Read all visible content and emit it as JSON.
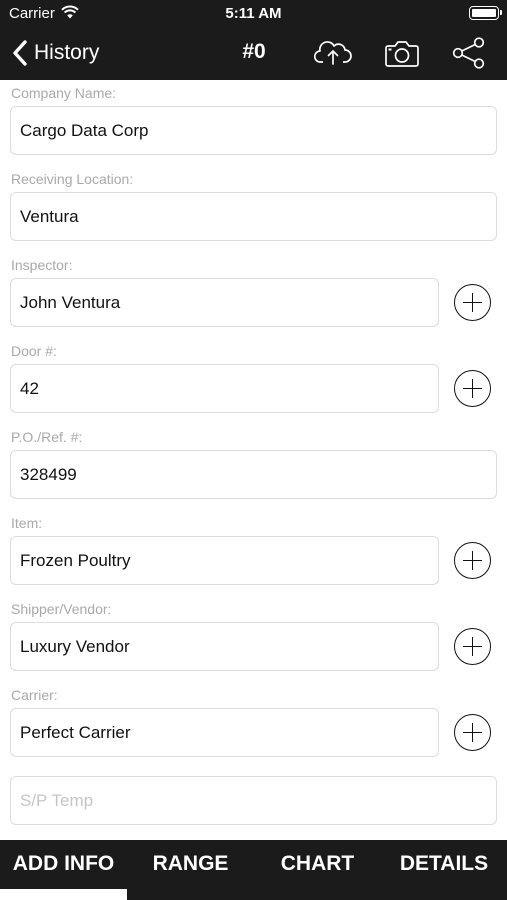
{
  "status_bar": {
    "carrier": "Carrier",
    "time": "5:11 AM"
  },
  "nav": {
    "back_label": "History",
    "title": "#0",
    "icons": [
      "chevron-left-icon",
      "cloud-upload-icon",
      "camera-icon",
      "share-icon"
    ]
  },
  "form": {
    "company": {
      "label": "Company Name:",
      "value": "Cargo Data Corp"
    },
    "location": {
      "label": "Receiving Location:",
      "value": "Ventura"
    },
    "inspector": {
      "label": "Inspector:",
      "value": "John Ventura"
    },
    "door": {
      "label": "Door #:",
      "value": "42"
    },
    "po": {
      "label": "P.O./Ref. #:",
      "value": "328499"
    },
    "item": {
      "label": "Item:",
      "value": "Frozen Poultry"
    },
    "shipper": {
      "label": "Shipper/Vendor:",
      "value": "Luxury Vendor"
    },
    "carrier": {
      "label": "Carrier:",
      "value": "Perfect Carrier"
    },
    "sp_temp": {
      "placeholder": "S/P Temp",
      "value": ""
    }
  },
  "tabs": [
    {
      "label": "ADD INFO",
      "selected": true
    },
    {
      "label": "RANGE",
      "selected": false
    },
    {
      "label": "CHART",
      "selected": false
    },
    {
      "label": "DETAILS",
      "selected": false
    }
  ],
  "colors": {
    "bar_background": "#1b1b1b",
    "label_gray": "#a9a9a9",
    "input_border": "#dcdcdc"
  }
}
